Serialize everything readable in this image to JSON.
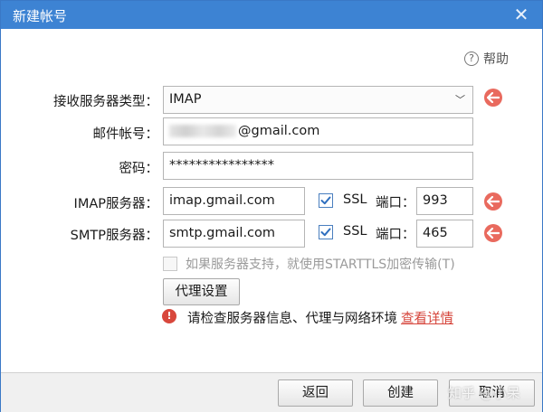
{
  "window": {
    "title": "新建帐号",
    "close_icon": "close-icon"
  },
  "help": {
    "icon": "?",
    "label": "帮助"
  },
  "form": {
    "server_type": {
      "label": "接收服务器类型：",
      "value": "IMAP"
    },
    "account": {
      "label": "邮件帐号：",
      "value": "@gmail.com"
    },
    "password": {
      "label": "密码：",
      "value": "****************"
    },
    "imap": {
      "label": "IMAP服务器：",
      "host": "imap.gmail.com",
      "ssl_label": "SSL",
      "ssl_checked": true,
      "port_label": "端口：",
      "port": "993"
    },
    "smtp": {
      "label": "SMTP服务器：",
      "host": "smtp.gmail.com",
      "ssl_label": "SSL",
      "ssl_checked": true,
      "port_label": "端口：",
      "port": "465"
    },
    "starttls": {
      "label": "如果服务器支持，就使用STARTTLS加密传输(T)",
      "checked": false
    },
    "proxy_button": "代理设置"
  },
  "error": {
    "icon": "!",
    "message": "请检查服务器信息、代理与网络环境",
    "link": "查看详情"
  },
  "footer": {
    "back_button": "返回",
    "create_button": "创建",
    "cancel_button": "取消"
  },
  "watermark": "知乎 @小呆",
  "colors": {
    "titlebar": "#3d83d3",
    "warning": "#e96a5e",
    "error": "#d8473c",
    "link": "#d6453b"
  }
}
